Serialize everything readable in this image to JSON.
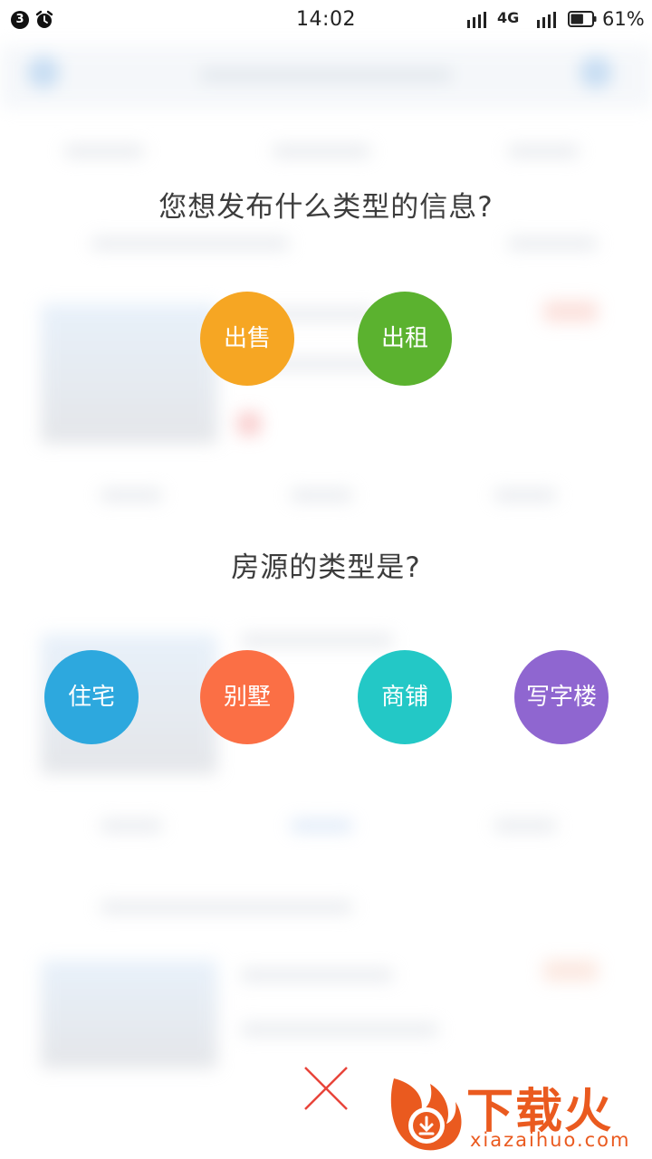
{
  "status_bar": {
    "notification_count": "3",
    "time": "14:02",
    "network": "4G",
    "battery_percent": "61%",
    "battery_level": 0.61
  },
  "publish_dialog": {
    "question_type": "您想发布什么类型的信息?",
    "transaction_options": [
      {
        "label": "出售",
        "color": "#f6a623"
      },
      {
        "label": "出租",
        "color": "#5bb22f"
      }
    ],
    "question_property": "房源的类型是?",
    "property_options": [
      {
        "label": "住宅",
        "color": "#2da8de"
      },
      {
        "label": "别墅",
        "color": "#fb6f45"
      },
      {
        "label": "商铺",
        "color": "#23c8c6"
      },
      {
        "label": "写字楼",
        "color": "#8f66d0"
      }
    ],
    "close_color": "#e8443a"
  },
  "watermark": {
    "brand": "下载火",
    "site": "xiazaihuo.com",
    "color": "#ea5a1f"
  }
}
